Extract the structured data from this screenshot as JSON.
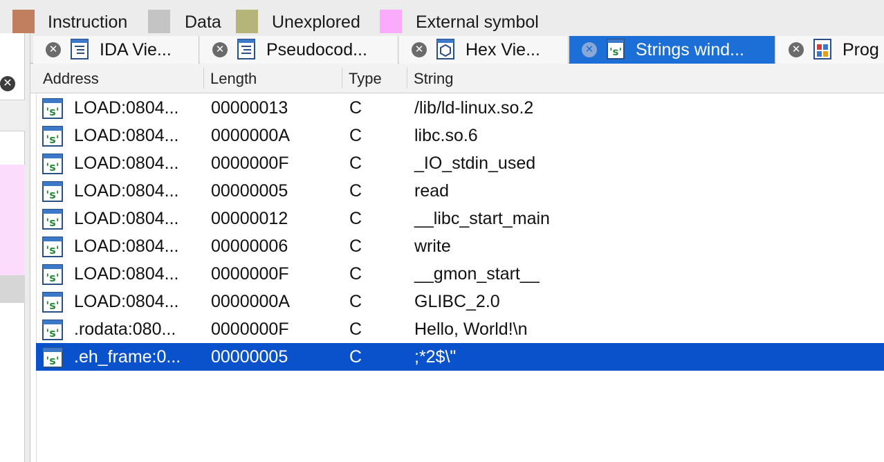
{
  "legend": {
    "items": [
      {
        "label": "Instruction",
        "color": "#c27f5f"
      },
      {
        "label": "Data",
        "color": "#c4c4c4"
      },
      {
        "label": "Unexplored",
        "color": "#b5b57a"
      },
      {
        "label": "External symbol",
        "color": "#fbabfb"
      }
    ]
  },
  "tabs": [
    {
      "label": "IDA Vie...",
      "icon": "ida-view-icon",
      "active": false
    },
    {
      "label": "Pseudocod...",
      "icon": "pseudocode-icon",
      "active": false
    },
    {
      "label": "Hex Vie...",
      "icon": "hex-view-icon",
      "active": false
    },
    {
      "label": "Strings wind...",
      "icon": "strings-icon",
      "active": true
    },
    {
      "label": "Prog",
      "icon": "program-segmentation-icon",
      "active": false
    }
  ],
  "table": {
    "columns": [
      "Address",
      "Length",
      "Type",
      "String"
    ],
    "rows": [
      {
        "address": "LOAD:0804...",
        "length": "00000013",
        "type": "C",
        "string": "/lib/ld-linux.so.2"
      },
      {
        "address": "LOAD:0804...",
        "length": "0000000A",
        "type": "C",
        "string": "libc.so.6"
      },
      {
        "address": "LOAD:0804...",
        "length": "0000000F",
        "type": "C",
        "string": "_IO_stdin_used"
      },
      {
        "address": "LOAD:0804...",
        "length": "00000005",
        "type": "C",
        "string": "read"
      },
      {
        "address": "LOAD:0804...",
        "length": "00000012",
        "type": "C",
        "string": "__libc_start_main"
      },
      {
        "address": "LOAD:0804...",
        "length": "00000006",
        "type": "C",
        "string": "write"
      },
      {
        "address": "LOAD:0804...",
        "length": "0000000F",
        "type": "C",
        "string": "__gmon_start__"
      },
      {
        "address": "LOAD:0804...",
        "length": "0000000A",
        "type": "C",
        "string": "GLIBC_2.0"
      },
      {
        "address": ".rodata:080...",
        "length": "0000000F",
        "type": "C",
        "string": "Hello, World!\\n"
      },
      {
        "address": ".eh_frame:0...",
        "length": "00000005",
        "type": "C",
        "string": ";*2$\\\"",
        "selected": true
      }
    ]
  },
  "colors": {
    "active_tab": "#1b6fd6",
    "selected_row": "#0a52cc",
    "external_pink": "#fcdcfc"
  }
}
